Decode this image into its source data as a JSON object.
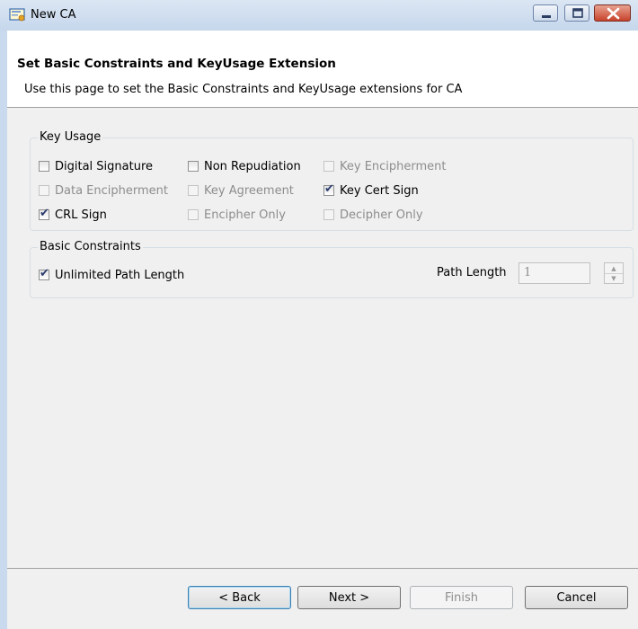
{
  "window": {
    "title": "New CA",
    "controls": {
      "minimize": "minimize",
      "maximize": "maximize",
      "close": "close"
    }
  },
  "header": {
    "title": "Set Basic Constraints and KeyUsage Extension",
    "description": "Use this page to set the Basic Constraints and KeyUsage extensions for CA"
  },
  "key_usage": {
    "label": "Key Usage",
    "options": [
      {
        "label": "Digital Signature",
        "checked": false,
        "enabled": true
      },
      {
        "label": "Non Repudiation",
        "checked": false,
        "enabled": true
      },
      {
        "label": "Key Encipherment",
        "checked": false,
        "enabled": false
      },
      {
        "label": "Data Encipherment",
        "checked": false,
        "enabled": false
      },
      {
        "label": "Key Agreement",
        "checked": false,
        "enabled": false
      },
      {
        "label": "Key Cert Sign",
        "checked": true,
        "enabled": true
      },
      {
        "label": "CRL Sign",
        "checked": true,
        "enabled": true
      },
      {
        "label": "Encipher Only",
        "checked": false,
        "enabled": false
      },
      {
        "label": "Decipher Only",
        "checked": false,
        "enabled": false
      }
    ]
  },
  "basic_constraints": {
    "label": "Basic Constraints",
    "unlimited_path_length": {
      "label": "Unlimited Path Length",
      "checked": true
    },
    "path_length": {
      "label": "Path Length",
      "value": "1",
      "enabled": false
    }
  },
  "buttons": {
    "back": "< Back",
    "next": "Next >",
    "finish": "Finish",
    "cancel": "Cancel"
  },
  "icons": {
    "app": "certificate-app-icon",
    "spin_up": "arrow-up-icon",
    "spin_down": "arrow-down-icon"
  },
  "colors": {
    "title_bar": "#c6d7ec",
    "close_button": "#c7432b",
    "checkmark": "#2a3b6d"
  }
}
